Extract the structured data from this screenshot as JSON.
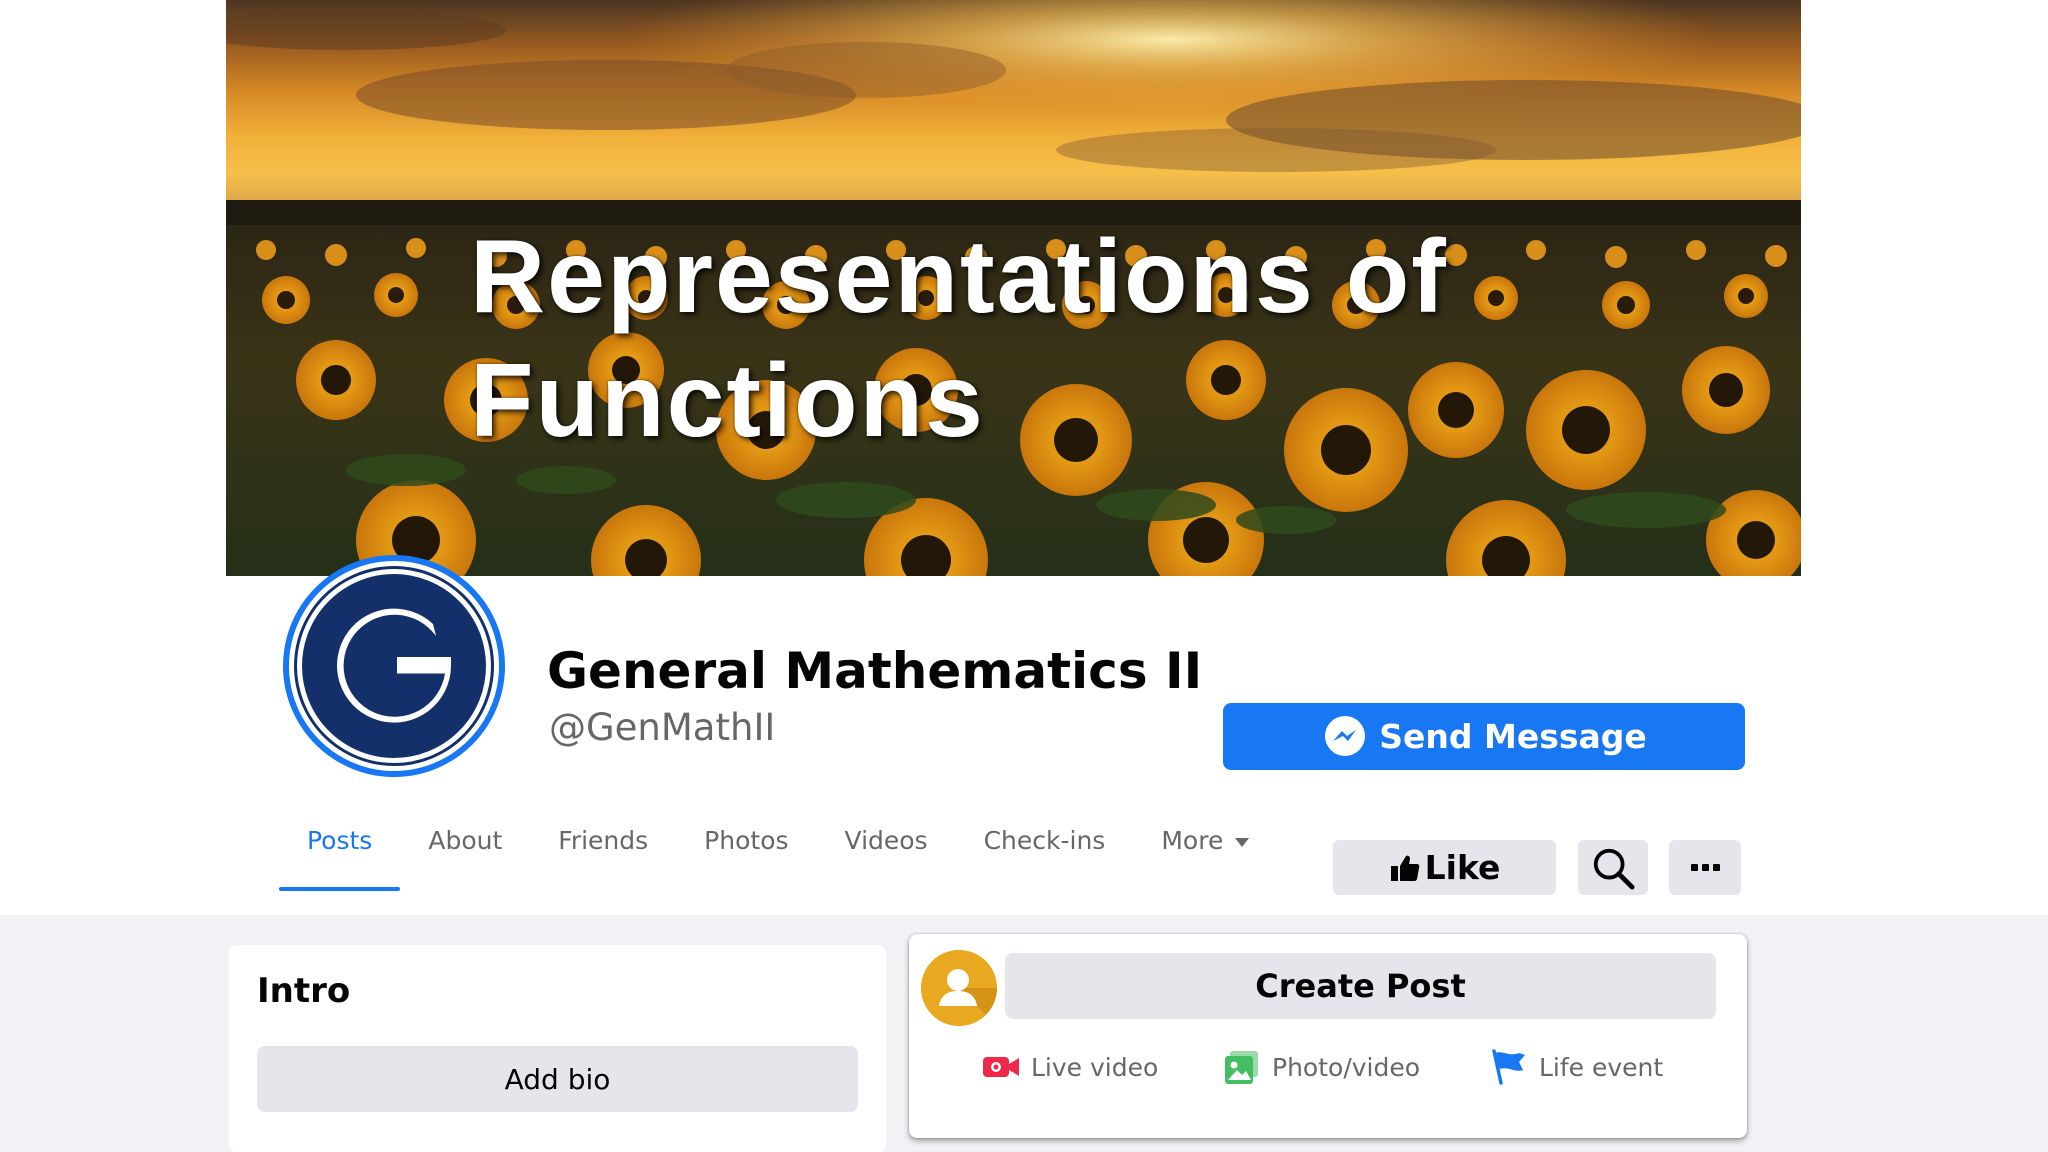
{
  "cover": {
    "title_line1": "Representations of",
    "title_line2": "Functions"
  },
  "profile": {
    "avatar_letter": "G",
    "name": "General Mathematics II",
    "handle": "@GenMathII",
    "send_message_label": "Send Message"
  },
  "tabs": [
    {
      "label": "Posts",
      "active": true
    },
    {
      "label": "About"
    },
    {
      "label": "Friends"
    },
    {
      "label": "Photos"
    },
    {
      "label": "Videos"
    },
    {
      "label": "Check-ins"
    },
    {
      "label": "More"
    }
  ],
  "actions": {
    "like_label": "Like"
  },
  "intro": {
    "title": "Intro",
    "add_bio_label": "Add bio"
  },
  "composer": {
    "create_post_label": "Create Post",
    "live_video_label": "Live video",
    "photo_video_label": "Photo/video",
    "life_event_label": "Life event"
  },
  "icons": {
    "messenger": "messenger-icon",
    "like": "thumbs-up-icon",
    "search": "search-icon",
    "more": "more-icon",
    "live": "live-video-icon",
    "photo": "photo-icon",
    "flag": "flag-icon"
  },
  "colors": {
    "accent": "#1877f2",
    "avatar_navy": "#14306a",
    "live_red": "#f02849",
    "photo_green": "#45bd62",
    "flag_blue": "#1877f2"
  }
}
